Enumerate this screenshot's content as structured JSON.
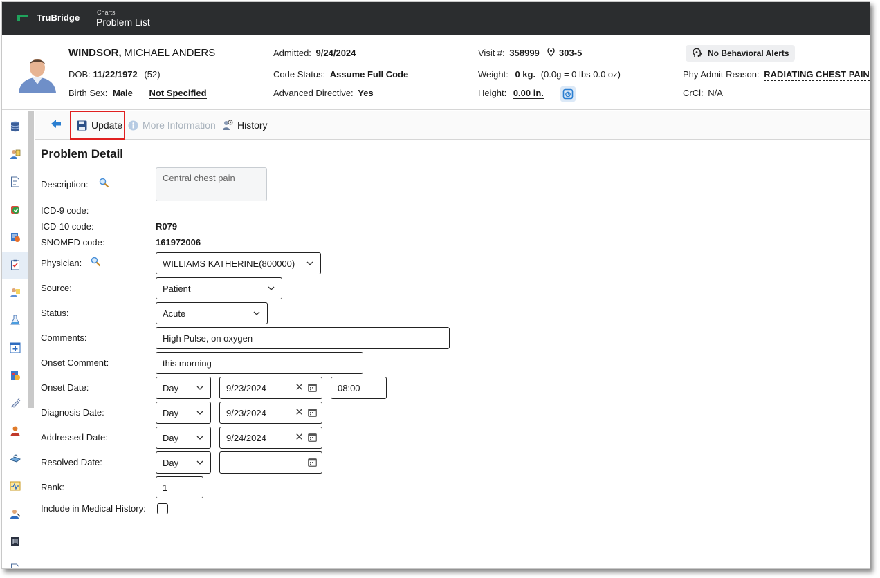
{
  "app": {
    "brand": "TruBridge",
    "breadcrumb_parent": "Charts",
    "page_title": "Problem List"
  },
  "patient": {
    "last_name": "WINDSOR,",
    "first_names": "MICHAEL ANDERS",
    "dob_label": "DOB:",
    "dob": "11/22/1972",
    "age": "(52)",
    "birth_sex_label": "Birth Sex:",
    "birth_sex": "Male",
    "gender_identity": "Not Specified",
    "admitted_label": "Admitted:",
    "admitted": "9/24/2024",
    "code_status_label": "Code Status:",
    "code_status": "Assume Full Code",
    "adv_directive_label": "Advanced Directive:",
    "adv_directive": "Yes",
    "visit_label": "Visit #:",
    "visit": "358999",
    "room": "303-5",
    "weight_label": "Weight:",
    "weight": "0 kg.",
    "weight_detail": "(0.0g = 0 lbs 0.0 oz)",
    "height_label": "Height:",
    "height": "0.00 in.",
    "alerts": "No Behavioral Alerts",
    "admit_reason_label": "Phy Admit Reason:",
    "admit_reason": "RADIATING CHEST PAIN",
    "crcl_label": "CrCl:",
    "crcl": "N/A"
  },
  "toolbar": {
    "update_label": "Update",
    "more_info_label": "More Information",
    "history_label": "History"
  },
  "form": {
    "title": "Problem Detail",
    "description_label": "Description:",
    "description": "Central chest pain",
    "icd9_label": "ICD-9 code:",
    "icd10_label": "ICD-10 code:",
    "icd10": "R079",
    "snomed_label": "SNOMED code:",
    "snomed": "161972006",
    "physician_label": "Physician:",
    "physician": "WILLIAMS KATHERINE(800000)",
    "source_label": "Source:",
    "source": "Patient",
    "status_label": "Status:",
    "status": "Acute",
    "comments_label": "Comments:",
    "comments": "High Pulse, on oxygen",
    "onset_comment_label": "Onset Comment:",
    "onset_comment": "this morning",
    "onset_date_label": "Onset Date:",
    "onset_precision": "Day",
    "onset_date": "9/23/2024",
    "onset_time": "08:00",
    "diagnosis_date_label": "Diagnosis Date:",
    "diagnosis_precision": "Day",
    "diagnosis_date": "9/23/2024",
    "addressed_date_label": "Addressed Date:",
    "addressed_precision": "Day",
    "addressed_date": "9/24/2024",
    "resolved_date_label": "Resolved Date:",
    "resolved_precision": "Day",
    "resolved_date": "",
    "rank_label": "Rank:",
    "rank": "1",
    "include_history_label": "Include in Medical History:",
    "include_history_checked": false
  },
  "colors": {
    "topbar": "#2b2d2f",
    "brand_green": "#1fa35c",
    "highlight_red": "#e02020",
    "icon_blue": "#2b7fd1"
  }
}
